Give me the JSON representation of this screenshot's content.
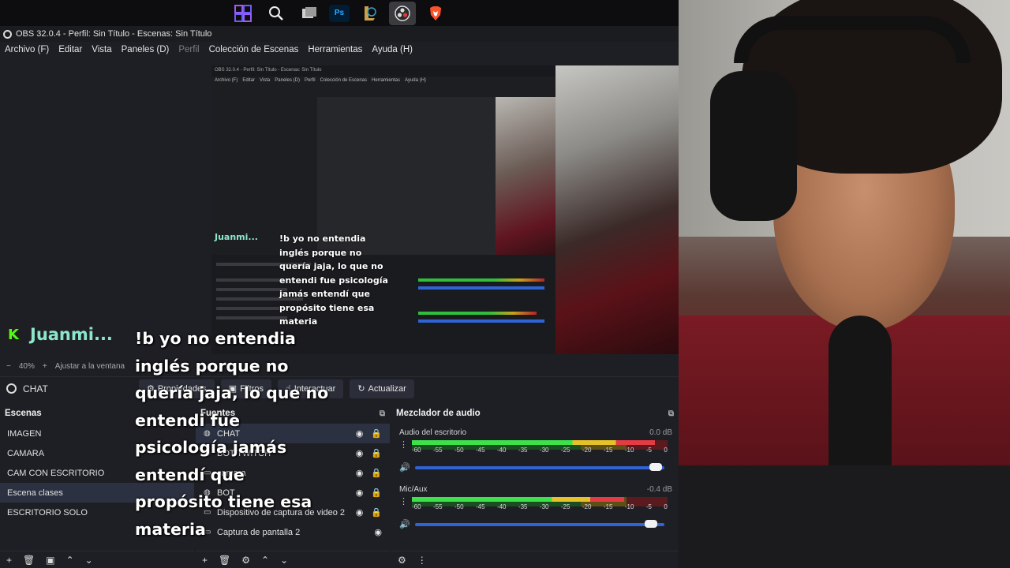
{
  "taskbar": {
    "icons": [
      "windows-icon",
      "search-icon",
      "task-view-icon",
      "photoshop-icon",
      "league-icon",
      "obs-taskbar-icon",
      "brave-icon"
    ],
    "ps_label": "Ps"
  },
  "window": {
    "title": "OBS 32.0.4 - Perfil: Sin Título - Escenas: Sin Título"
  },
  "menu": {
    "archivo": "Archivo (F)",
    "editar": "Editar",
    "vista": "Vista",
    "paneles": "Paneles (D)",
    "perfil": "Perfil",
    "coleccion": "Colección de Escenas",
    "herramientas": "Herramientas",
    "ayuda": "Ayuda (H)"
  },
  "nested": {
    "title": "OBS 32.0.4 - Perfil: Sin Título - Escenas: Sin Título",
    "menu": [
      "Archivo (F)",
      "Editar",
      "Vista",
      "Paneles (D)",
      "Perfil",
      "Colección de Escenas",
      "Herramientas",
      "Ayuda (H)"
    ],
    "chat_name": "Juanmi...",
    "chat_message": "!b yo no entendia inglés porque no quería jaja, lo que no entendi fue psicología jamás entendí que propósito tiene esa materia"
  },
  "zoom": {
    "minus": "−",
    "value": "40%",
    "plus": "+",
    "fit": "Ajustar a la ventana"
  },
  "sourcebar": {
    "name": "CHAT",
    "properties": "Propiedades",
    "filters": "Filtros",
    "interact": "Interactuar",
    "refresh": "Actualizar"
  },
  "scenes": {
    "title": "Escenas",
    "items": [
      "IMAGEN",
      "CAMARA",
      "CAM CON ESCRITORIO",
      "Escena clases",
      "ESCRITORIO SOLO"
    ],
    "selected_index": 3
  },
  "sources": {
    "title": "Fuentes",
    "items": [
      "CHAT",
      "BOT TWITCH",
      "camara",
      "BOT",
      "Dispositivo de captura de video 2",
      "Captura de pantalla 2"
    ]
  },
  "mixer": {
    "title": "Mezclador de audio",
    "channels": [
      {
        "name": "Audio del escritorio",
        "db": "0.0 dB",
        "level": 0.95,
        "fader": 0.99
      },
      {
        "name": "Mic/Aux",
        "db": "-0.4 dB",
        "level": 0.83,
        "fader": 0.97
      }
    ],
    "ticks": [
      "-60",
      "-55",
      "-50",
      "-45",
      "-40",
      "-35",
      "-30",
      "-25",
      "-20",
      "-15",
      "-10",
      "-5",
      "0"
    ]
  },
  "chat": {
    "badge": "K",
    "name": "Juanmi...",
    "message": "!b yo no entendia inglés porque no quería jaja, lo que no entendi fue psicología jamás entendí que propósito tiene esa materia"
  },
  "colors": {
    "accent": "#2f64d6",
    "kick_green": "#53fc18",
    "chat_name": "#8ee6c9"
  }
}
